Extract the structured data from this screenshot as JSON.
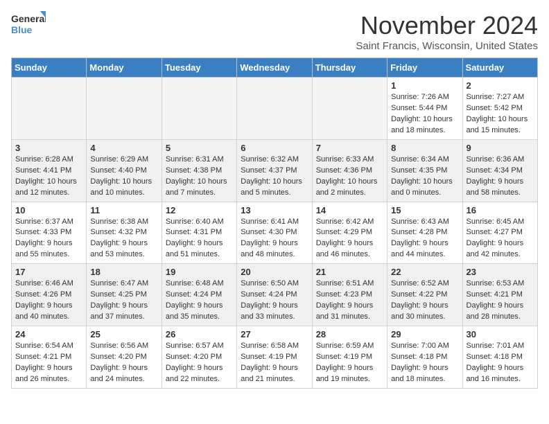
{
  "logo": {
    "line1": "General",
    "line2": "Blue"
  },
  "header": {
    "month": "November 2024",
    "location": "Saint Francis, Wisconsin, United States"
  },
  "weekdays": [
    "Sunday",
    "Monday",
    "Tuesday",
    "Wednesday",
    "Thursday",
    "Friday",
    "Saturday"
  ],
  "weeks": [
    [
      {
        "day": "",
        "empty": true
      },
      {
        "day": "",
        "empty": true
      },
      {
        "day": "",
        "empty": true
      },
      {
        "day": "",
        "empty": true
      },
      {
        "day": "",
        "empty": true
      },
      {
        "day": "1",
        "sunrise": "Sunrise: 7:26 AM",
        "sunset": "Sunset: 5:44 PM",
        "daylight": "Daylight: 10 hours and 18 minutes."
      },
      {
        "day": "2",
        "sunrise": "Sunrise: 7:27 AM",
        "sunset": "Sunset: 5:42 PM",
        "daylight": "Daylight: 10 hours and 15 minutes."
      }
    ],
    [
      {
        "day": "3",
        "sunrise": "Sunrise: 6:28 AM",
        "sunset": "Sunset: 4:41 PM",
        "daylight": "Daylight: 10 hours and 12 minutes."
      },
      {
        "day": "4",
        "sunrise": "Sunrise: 6:29 AM",
        "sunset": "Sunset: 4:40 PM",
        "daylight": "Daylight: 10 hours and 10 minutes."
      },
      {
        "day": "5",
        "sunrise": "Sunrise: 6:31 AM",
        "sunset": "Sunset: 4:38 PM",
        "daylight": "Daylight: 10 hours and 7 minutes."
      },
      {
        "day": "6",
        "sunrise": "Sunrise: 6:32 AM",
        "sunset": "Sunset: 4:37 PM",
        "daylight": "Daylight: 10 hours and 5 minutes."
      },
      {
        "day": "7",
        "sunrise": "Sunrise: 6:33 AM",
        "sunset": "Sunset: 4:36 PM",
        "daylight": "Daylight: 10 hours and 2 minutes."
      },
      {
        "day": "8",
        "sunrise": "Sunrise: 6:34 AM",
        "sunset": "Sunset: 4:35 PM",
        "daylight": "Daylight: 10 hours and 0 minutes."
      },
      {
        "day": "9",
        "sunrise": "Sunrise: 6:36 AM",
        "sunset": "Sunset: 4:34 PM",
        "daylight": "Daylight: 9 hours and 58 minutes."
      }
    ],
    [
      {
        "day": "10",
        "sunrise": "Sunrise: 6:37 AM",
        "sunset": "Sunset: 4:33 PM",
        "daylight": "Daylight: 9 hours and 55 minutes."
      },
      {
        "day": "11",
        "sunrise": "Sunrise: 6:38 AM",
        "sunset": "Sunset: 4:32 PM",
        "daylight": "Daylight: 9 hours and 53 minutes."
      },
      {
        "day": "12",
        "sunrise": "Sunrise: 6:40 AM",
        "sunset": "Sunset: 4:31 PM",
        "daylight": "Daylight: 9 hours and 51 minutes."
      },
      {
        "day": "13",
        "sunrise": "Sunrise: 6:41 AM",
        "sunset": "Sunset: 4:30 PM",
        "daylight": "Daylight: 9 hours and 48 minutes."
      },
      {
        "day": "14",
        "sunrise": "Sunrise: 6:42 AM",
        "sunset": "Sunset: 4:29 PM",
        "daylight": "Daylight: 9 hours and 46 minutes."
      },
      {
        "day": "15",
        "sunrise": "Sunrise: 6:43 AM",
        "sunset": "Sunset: 4:28 PM",
        "daylight": "Daylight: 9 hours and 44 minutes."
      },
      {
        "day": "16",
        "sunrise": "Sunrise: 6:45 AM",
        "sunset": "Sunset: 4:27 PM",
        "daylight": "Daylight: 9 hours and 42 minutes."
      }
    ],
    [
      {
        "day": "17",
        "sunrise": "Sunrise: 6:46 AM",
        "sunset": "Sunset: 4:26 PM",
        "daylight": "Daylight: 9 hours and 40 minutes."
      },
      {
        "day": "18",
        "sunrise": "Sunrise: 6:47 AM",
        "sunset": "Sunset: 4:25 PM",
        "daylight": "Daylight: 9 hours and 37 minutes."
      },
      {
        "day": "19",
        "sunrise": "Sunrise: 6:48 AM",
        "sunset": "Sunset: 4:24 PM",
        "daylight": "Daylight: 9 hours and 35 minutes."
      },
      {
        "day": "20",
        "sunrise": "Sunrise: 6:50 AM",
        "sunset": "Sunset: 4:24 PM",
        "daylight": "Daylight: 9 hours and 33 minutes."
      },
      {
        "day": "21",
        "sunrise": "Sunrise: 6:51 AM",
        "sunset": "Sunset: 4:23 PM",
        "daylight": "Daylight: 9 hours and 31 minutes."
      },
      {
        "day": "22",
        "sunrise": "Sunrise: 6:52 AM",
        "sunset": "Sunset: 4:22 PM",
        "daylight": "Daylight: 9 hours and 30 minutes."
      },
      {
        "day": "23",
        "sunrise": "Sunrise: 6:53 AM",
        "sunset": "Sunset: 4:21 PM",
        "daylight": "Daylight: 9 hours and 28 minutes."
      }
    ],
    [
      {
        "day": "24",
        "sunrise": "Sunrise: 6:54 AM",
        "sunset": "Sunset: 4:21 PM",
        "daylight": "Daylight: 9 hours and 26 minutes."
      },
      {
        "day": "25",
        "sunrise": "Sunrise: 6:56 AM",
        "sunset": "Sunset: 4:20 PM",
        "daylight": "Daylight: 9 hours and 24 minutes."
      },
      {
        "day": "26",
        "sunrise": "Sunrise: 6:57 AM",
        "sunset": "Sunset: 4:20 PM",
        "daylight": "Daylight: 9 hours and 22 minutes."
      },
      {
        "day": "27",
        "sunrise": "Sunrise: 6:58 AM",
        "sunset": "Sunset: 4:19 PM",
        "daylight": "Daylight: 9 hours and 21 minutes."
      },
      {
        "day": "28",
        "sunrise": "Sunrise: 6:59 AM",
        "sunset": "Sunset: 4:19 PM",
        "daylight": "Daylight: 9 hours and 19 minutes."
      },
      {
        "day": "29",
        "sunrise": "Sunrise: 7:00 AM",
        "sunset": "Sunset: 4:18 PM",
        "daylight": "Daylight: 9 hours and 18 minutes."
      },
      {
        "day": "30",
        "sunrise": "Sunrise: 7:01 AM",
        "sunset": "Sunset: 4:18 PM",
        "daylight": "Daylight: 9 hours and 16 minutes."
      }
    ]
  ]
}
